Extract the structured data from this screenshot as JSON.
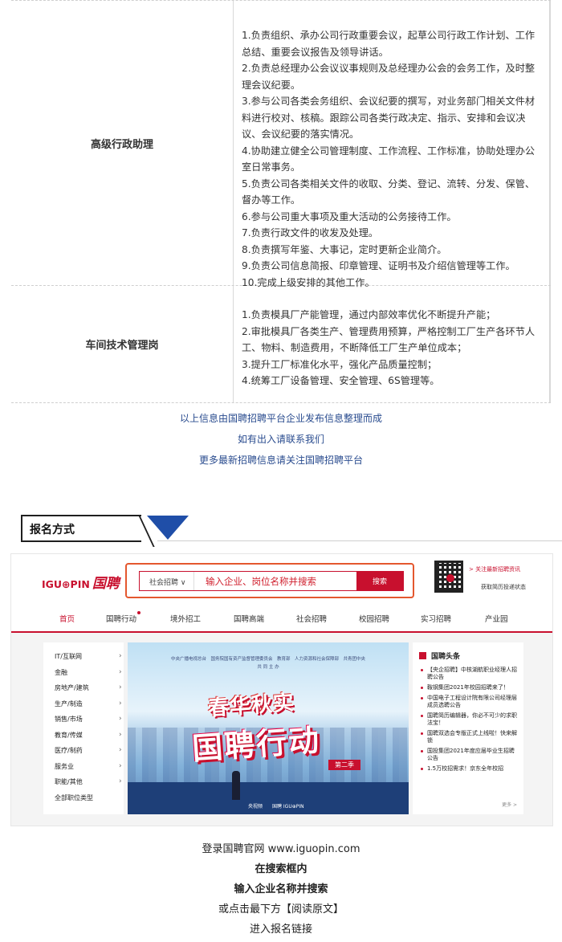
{
  "jobs": [
    {
      "title": "高级行政助理",
      "duties": [
        "1.负责组织、承办公司行政重要会议，起草公司行政工作计划、工作",
        "总结、重要会议报告及领导讲话。",
        "2.负责总经理办公会议议事规则及总经理办公会的会务工作，及时整",
        "理会议纪要。",
        "3.参与公司各类会务组织、会议纪要的撰写，对业务部门相关文件材",
        "料进行校对、核稿。跟踪公司各类行政决定、指示、安排和会议决",
        "议、会议纪要的落实情况。",
        "4.协助建立健全公司管理制度、工作流程、工作标准，协助处理办公",
        "室日常事务。",
        "5.负责公司各类相关文件的收取、分类、登记、流转、分发、保管、",
        "督办等工作。",
        "6.参与公司重大事项及重大活动的公务接待工作。",
        "7.负责行政文件的收发及处理。",
        "8.负责撰写年鉴、大事记，定时更新企业简介。",
        "9.负责公司信息简报、印章管理、证明书及介绍信管理等工作。",
        "10.完成上级安排的其他工作。"
      ]
    },
    {
      "title": "车间技术管理岗",
      "duties": [
        "1.负责模具厂产能管理，通过内部效率优化不断提升产能；",
        "2.审批模具厂各类生产、管理费用预算，严格控制工厂生产各环节人",
        "工、物料、制造费用，不断降低工厂生产单位成本；",
        "3.提升工厂标准化水平，强化产品质量控制；",
        "4.统筹工厂设备管理、安全管理、6S管理等。"
      ]
    }
  ],
  "notes": [
    "以上信息由国聘招聘平台企业发布信息整理而成",
    "如有出入请联系我们",
    "更多最新招聘信息请关注国聘招聘平台"
  ],
  "section": {
    "title": "报名方式"
  },
  "site": {
    "logo_en": "IGU⊕PIN",
    "logo_cn": "国聘",
    "search_category": "社会招聘 ∨",
    "search_placeholder": "输入企业、岗位名称并搜索",
    "search_button": "搜索",
    "qr_text1": "> 关注最新招聘资讯",
    "qr_text2": "获取简历投递状态",
    "nav": [
      "首页",
      "国聘行动",
      "境外招工",
      "国聘高端",
      "社会招聘",
      "校园招聘",
      "实习招聘",
      "产业园"
    ],
    "categories": [
      "IT/互联网",
      "金融",
      "房地产/建筑",
      "生产/制造",
      "销售/市场",
      "教育/传媒",
      "医疗/制药",
      "服务业",
      "职能/其他",
      "全部职位类型"
    ],
    "banner": {
      "top_line": "中央广播电视总台　国务院国有资产监督管理委员会　教育部　人力资源和社会保障部　共青团中央",
      "sub_line": "共 同 主 办",
      "title1": "春华秋实",
      "title2": "国聘行动",
      "season": "第二季",
      "logos": "央视频　　国聘 IGU⊕PIN"
    },
    "news_title": "国聘头条",
    "news": [
      "【央企招聘】中核湖航职业经理人招聘公告",
      "鞍钢集团2021年校园招聘来了！",
      "中国电子工程设计院有限公司经理层成员选聘公告",
      "国聘简历编辑器，你必不可少的求职法宝！",
      "国聘双选会专版正式上线啦！快来解锁",
      "国投集团2021年度应届毕业生招聘公告",
      "1.5万校招需求！京东全年校招"
    ],
    "news_more": "更多 >"
  },
  "footer": [
    "登录国聘官网 www.iguopin.com",
    "在搜索框内",
    "输入企业名称并搜索",
    "或点击最下方【阅读原文】",
    "进入报名链接"
  ],
  "colors": {
    "brand_red": "#c8102e",
    "link_blue": "#2a4c8f",
    "accent_blue": "#1f4ea8",
    "search_frame": "#e4572e"
  }
}
